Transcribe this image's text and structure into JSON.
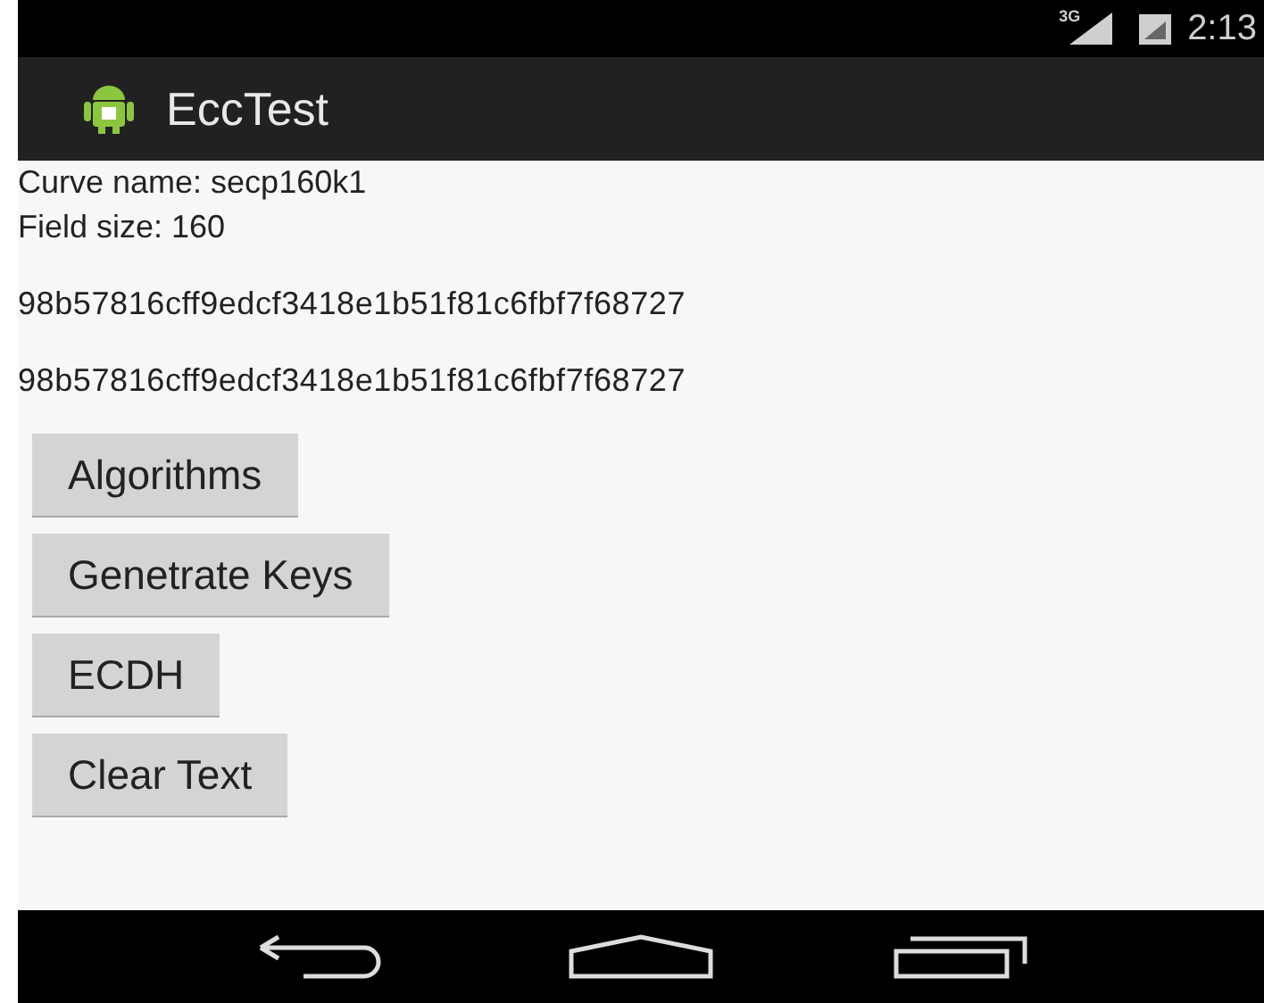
{
  "status_bar": {
    "network": "3G",
    "time": "2:13"
  },
  "action_bar": {
    "title": "EccTest"
  },
  "lines": [
    {
      "kind": "label",
      "text": "Curve name: secp160k1"
    },
    {
      "kind": "label",
      "text": "Field size: 160"
    },
    {
      "kind": "hex",
      "text": "98b57816cff9edcf3418e1b51f81c6fbf7f68727"
    },
    {
      "kind": "hex",
      "text": "98b57816cff9edcf3418e1b51f81c6fbf7f68727"
    }
  ],
  "buttons": [
    "Algorithms",
    "Genetrate Keys",
    "ECDH",
    "Clear Text"
  ]
}
